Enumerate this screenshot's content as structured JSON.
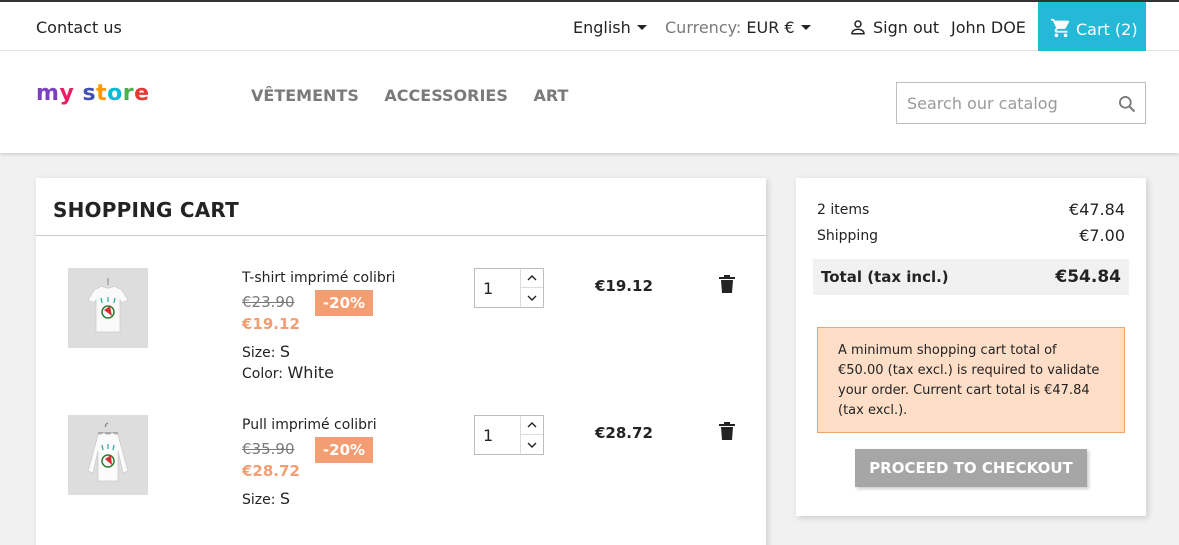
{
  "topbar": {
    "contact": "Contact us",
    "language": "English",
    "currency_label": "Currency:",
    "currency_value": "EUR €",
    "sign_out": "Sign out",
    "user_name": "John DOE",
    "cart_label": "Cart (2)"
  },
  "header": {
    "logo_text": "my store",
    "nav": [
      "VÊTEMENTS",
      "ACCESSORIES",
      "ART"
    ],
    "search_placeholder": "Search our catalog"
  },
  "cart": {
    "title": "SHOPPING CART",
    "items": [
      {
        "name": "T-shirt imprimé colibri",
        "old_price": "€23.90",
        "discount": "-20%",
        "new_price": "€19.12",
        "attrs": [
          {
            "label": "Size:",
            "value": "S"
          },
          {
            "label": "Color:",
            "value": "White"
          }
        ],
        "quantity": "1",
        "total": "€19.12"
      },
      {
        "name": "Pull imprimé colibri",
        "old_price": "€35.90",
        "discount": "-20%",
        "new_price": "€28.72",
        "attrs": [
          {
            "label": "Size:",
            "value": "S"
          }
        ],
        "quantity": "1",
        "total": "€28.72"
      }
    ]
  },
  "summary": {
    "items_label": "2 items",
    "items_value": "€47.84",
    "shipping_label": "Shipping",
    "shipping_value": "€7.00",
    "total_label": "Total (tax incl.)",
    "total_value": "€54.84",
    "alert": "A minimum shopping cart total of €50.00 (tax excl.) is required to validate your order. Current cart total is €47.84 (tax excl.).",
    "checkout": "PROCEED TO CHECKOUT"
  },
  "colors": {
    "accent": "#24b9d7",
    "discount": "#f39d72",
    "alert_bg": "#ffdec8"
  }
}
